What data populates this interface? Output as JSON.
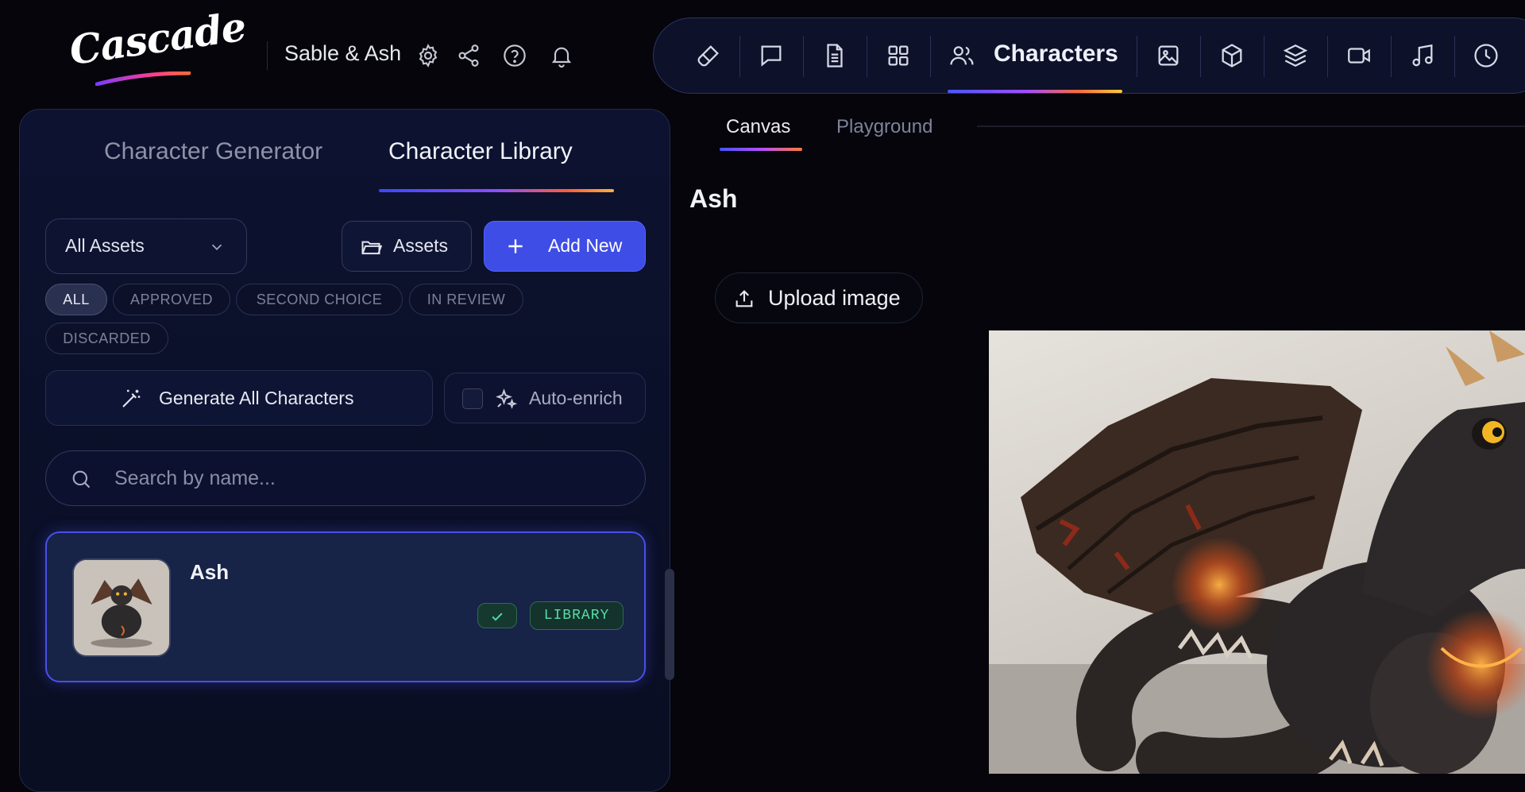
{
  "app": {
    "logo_text": "Cascade",
    "project_name": "Sable & Ash"
  },
  "header_icons": [
    "gear-icon",
    "share-icon",
    "help-icon",
    "bell-icon"
  ],
  "top_nav": {
    "active_label": "Characters",
    "items": [
      "brush-icon",
      "chat-icon",
      "document-icon",
      "grid-icon",
      "users-icon",
      "image-icon",
      "cube-icon",
      "layers-icon",
      "video-icon",
      "music-icon",
      "clock-icon"
    ]
  },
  "left_panel": {
    "tabs": [
      "Character Generator",
      "Character Library"
    ],
    "active_tab": "Character Library",
    "filter_select": {
      "value": "All Assets"
    },
    "assets_button": "Assets",
    "add_new_button": "Add New",
    "status_chips": [
      "ALL",
      "APPROVED",
      "SECOND CHOICE",
      "IN REVIEW",
      "DISCARDED"
    ],
    "active_chip": "ALL",
    "generate_all_button": "Generate All Characters",
    "auto_enrich": {
      "label": "Auto-enrich",
      "checked": false
    },
    "search": {
      "placeholder": "Search by name...",
      "value": ""
    },
    "characters": [
      {
        "name": "Ash",
        "status_badge": "LIBRARY",
        "approved": true
      }
    ]
  },
  "main": {
    "subtabs": [
      "Canvas",
      "Playground"
    ],
    "active_subtab": "Canvas",
    "title": "Ash",
    "upload_button": "Upload image"
  },
  "colors": {
    "accent": "#3e4de6",
    "background": "#05050b",
    "panel": "#0c1230",
    "success": "#50d7a0"
  }
}
